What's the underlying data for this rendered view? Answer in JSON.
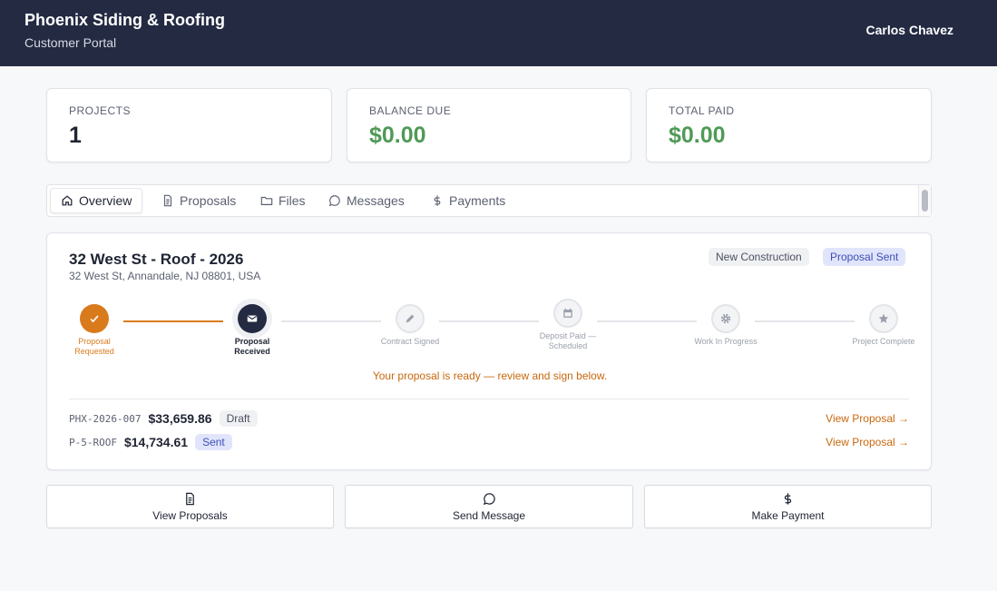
{
  "header": {
    "brand": "Phoenix Siding & Roofing",
    "subtitle": "Customer Portal",
    "user": "Carlos Chavez"
  },
  "stats": [
    {
      "label": "PROJECTS",
      "value": "1"
    },
    {
      "label": "BALANCE DUE",
      "value": "$0.00"
    },
    {
      "label": "TOTAL PAID",
      "value": "$0.00"
    }
  ],
  "tabs": [
    {
      "label": "Overview",
      "icon": "home-icon"
    },
    {
      "label": "Proposals",
      "icon": "document-icon"
    },
    {
      "label": "Files",
      "icon": "folder-icon"
    },
    {
      "label": "Messages",
      "icon": "message-icon"
    },
    {
      "label": "Payments",
      "icon": "dollar-icon"
    }
  ],
  "project": {
    "title": "32 West St - Roof - 2026",
    "address": "32 West St, Annandale, NJ 08801, USA",
    "badges": [
      "New Construction",
      "Proposal Sent"
    ],
    "steps": [
      {
        "label": "Proposal Requested",
        "status": "done",
        "icon": "check-icon"
      },
      {
        "label": "Proposal Received",
        "status": "current",
        "icon": "envelope-icon"
      },
      {
        "label": "Contract Signed",
        "status": "pending",
        "icon": "pencil-icon"
      },
      {
        "label": "Deposit Paid — Scheduled",
        "status": "pending",
        "icon": "calendar-icon"
      },
      {
        "label": "Work In Progress",
        "status": "pending",
        "icon": "gear-icon"
      },
      {
        "label": "Project Complete",
        "status": "pending",
        "icon": "star-icon"
      }
    ],
    "message": "Your proposal is ready — review and sign below.",
    "proposals": [
      {
        "number": "PHX-2026-007",
        "amount": "$33,659.86",
        "status": "Draft",
        "link": "View Proposal →"
      },
      {
        "number": "P-5-ROOF",
        "amount": "$14,734.61",
        "status": "Sent",
        "link": "View Proposal →"
      }
    ]
  },
  "actions": [
    {
      "label": "View Proposals",
      "icon": "document-icon"
    },
    {
      "label": "Send Message",
      "icon": "message-icon"
    },
    {
      "label": "Make Payment",
      "icon": "dollar-icon"
    }
  ],
  "colors": {
    "header_bg": "#232a42",
    "accent": "#d97a1d",
    "money": "#4f9a57",
    "badge_blue": "#3e4fb8"
  }
}
